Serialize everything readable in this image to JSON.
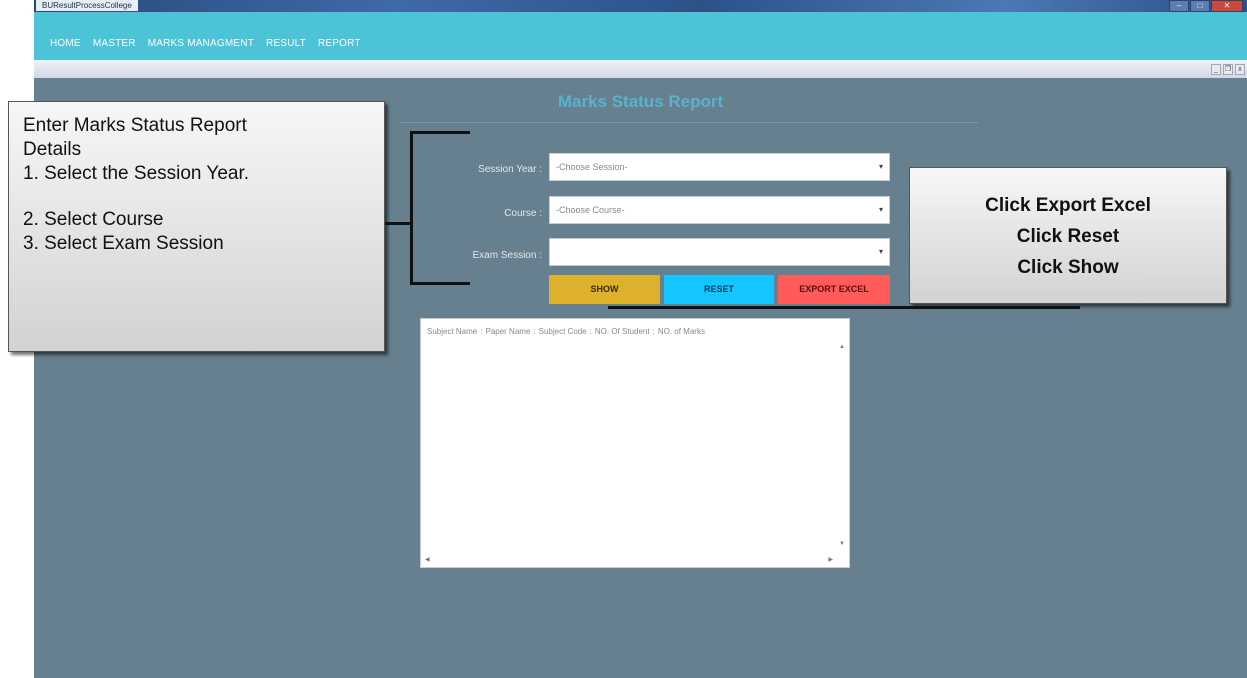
{
  "window": {
    "title": "BUResultProcessCollege",
    "controls": [
      "–",
      "□",
      "✕"
    ]
  },
  "menu": [
    "HOME",
    "MASTER",
    "MARKS MANAGMENT",
    "RESULT",
    "REPORT"
  ],
  "mdi_controls": [
    "_",
    "❐",
    "x"
  ],
  "page": {
    "title": "Marks Status Report"
  },
  "form": {
    "session_year": {
      "label": "Session Year :",
      "value": "-Choose Session-"
    },
    "course": {
      "label": "Course :",
      "value": "-Choose Course-"
    },
    "exam_session": {
      "label": "Exam Session :",
      "value": ""
    }
  },
  "buttons": {
    "show": "SHOW",
    "reset": "RESET",
    "export": "EXPORT EXCEL"
  },
  "grid": {
    "columns": [
      "Subject Name",
      "Paper Name",
      "Subject Code",
      "NO. Of Student",
      "NO. of Marks"
    ],
    "rows": []
  },
  "annotations": {
    "left": {
      "lines": [
        "Enter Marks Status Report",
        "Details",
        "1. Select the Session Year.",
        "2. Select Course",
        "3. Select Exam Session"
      ]
    },
    "right": {
      "lines": [
        "Click Export Excel",
        "Click Reset",
        "Click Show"
      ]
    }
  },
  "colors": {
    "menubar": "#4cc3d6",
    "background": "#66808f",
    "title": "#57b3cc",
    "show": "#ddb12b",
    "reset": "#14c5ff",
    "export": "#ff5b5b"
  }
}
